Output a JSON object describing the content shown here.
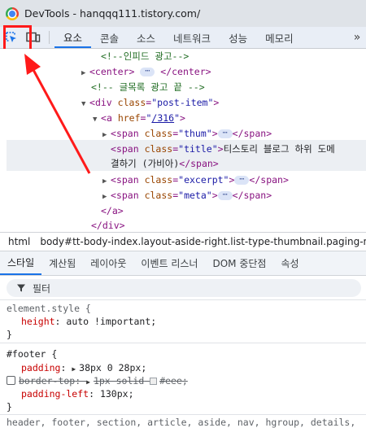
{
  "window": {
    "title": "DevTools - hanqqq111.tistory.com/"
  },
  "toolbar": {
    "inspect_icon": "inspect-element-icon",
    "device_icon": "device-toolbar-icon",
    "tabs": [
      {
        "label": "요소"
      },
      {
        "label": "콘솔"
      },
      {
        "label": "소스"
      },
      {
        "label": "네트워크"
      },
      {
        "label": "성능"
      },
      {
        "label": "메모리"
      }
    ],
    "more": "»"
  },
  "dom": {
    "lines": [
      {
        "comment": "<!--인피드 광고-->"
      },
      {
        "open": "<center>",
        "close": "</center>"
      },
      {
        "comment": "<!-- 글목록 광고 끝 -->"
      },
      {
        "tag": "div",
        "attr": "class",
        "value": "post-item"
      },
      {
        "tag": "a",
        "attr": "href",
        "value": "/316"
      },
      {
        "tag": "span",
        "attr": "class",
        "value": "thum",
        "close": "</span>"
      },
      {
        "tag": "span",
        "attr": "class",
        "value": "title",
        "text": "티스토리 블로그 하위 도메",
        "text2": "결하기 (가비아)",
        "close": "</span>"
      },
      {
        "tag": "span",
        "attr": "class",
        "value": "excerpt",
        "close": "</span>"
      },
      {
        "tag": "span",
        "attr": "class",
        "value": "meta",
        "close": "</span>"
      },
      {
        "close": "</a>"
      },
      {
        "close": "</div>"
      }
    ]
  },
  "breadcrumb": {
    "items": [
      "html",
      "body#tt-body-index.layout-aside-right.list-type-thumbnail.paging-n"
    ]
  },
  "styles": {
    "tabs": [
      "스타일",
      "계산됨",
      "레이아웃",
      "이벤트 리스너",
      "DOM 중단점",
      "속성"
    ],
    "filter_placeholder": "필터",
    "element_style": {
      "selector": "element.style {",
      "prop": "height",
      "value": "auto !important;",
      "close": "}"
    },
    "footer_rule": {
      "selector": "#footer {",
      "padding_prop": "padding",
      "padding_value": "38px 0 28px;",
      "border_prop": "border-top",
      "border_value": "1px solid",
      "border_color": "#eee;",
      "padding_left_prop": "padding-left",
      "padding_left_value": "130px;",
      "close": "}"
    },
    "inherited_selectors": "header, footer, section, article, aside, nav, hgroup, details,"
  },
  "colors": {
    "annotation": "#ff1a1a",
    "accent": "#1a73e8"
  }
}
